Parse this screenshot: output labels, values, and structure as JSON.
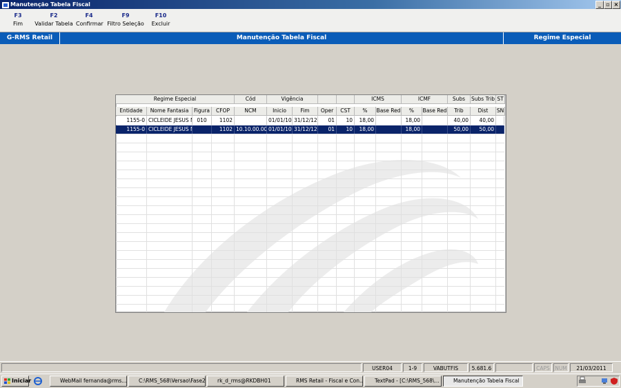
{
  "window": {
    "title": "Manutenção Tabela Fiscal",
    "buttons": [
      "_",
      "▫",
      "×"
    ]
  },
  "toolbar": {
    "items": [
      {
        "key": "F3",
        "label": "Fim"
      },
      {
        "key": "F2",
        "label": "Validar Tabela"
      },
      {
        "key": "F4",
        "label": "Confirmar"
      },
      {
        "key": "F9",
        "label": "Filtro Seleção"
      },
      {
        "key": "F10",
        "label": "Excluir"
      }
    ]
  },
  "header": {
    "left": "G-RMS Retail",
    "center": "Manutenção Tabela Fiscal",
    "right": "Regime Especial"
  },
  "grid": {
    "group_headers": [
      "Regime Especial",
      "Cód",
      "Vigência",
      "",
      "",
      "ICMS",
      "ICMF",
      "Subs",
      "Subs Trib",
      "ST"
    ],
    "columns": [
      "Entidade",
      "Nome Fantasia",
      "Figura",
      "CFOP",
      "NCM",
      "Inicio",
      "Fim",
      "Oper",
      "CST",
      "%",
      "Base Red",
      "%",
      "Base Red",
      "Trib",
      "Dist",
      "SN"
    ],
    "rows": [
      [
        "1155-0",
        "CICLEIDE JESUS N",
        "010",
        "1102",
        "",
        "01/01/10",
        "31/12/12",
        "01",
        "10",
        "18,00",
        "",
        "18,00",
        "",
        "40,00",
        "40,00",
        ""
      ],
      [
        "1155-0",
        "CICLEIDE JESUS N",
        "",
        "1102",
        "10.10.00.00",
        "01/01/10",
        "31/12/12",
        "01",
        "10",
        "18,00",
        "",
        "18,00",
        "",
        "50,00",
        "50,00",
        ""
      ]
    ],
    "selected_row": 1
  },
  "status": {
    "user": "USER04",
    "page": "1-9",
    "db": "VABUTFIS",
    "version": "5.681.6",
    "caps": "CAPS",
    "num": "NUM",
    "date": "21/03/2011"
  },
  "taskbar": {
    "start": "Iniciar",
    "tasks": [
      "WebMail fernanda@rms....",
      "C:\\RMS_568\\Versao\\Fase2",
      "rk_d_rms@RKDBH01",
      "RMS Retail - Fiscal e Con...",
      "TextPad - [C:\\RMS_568\\...",
      "Manutenção Tabela Fiscal"
    ]
  }
}
